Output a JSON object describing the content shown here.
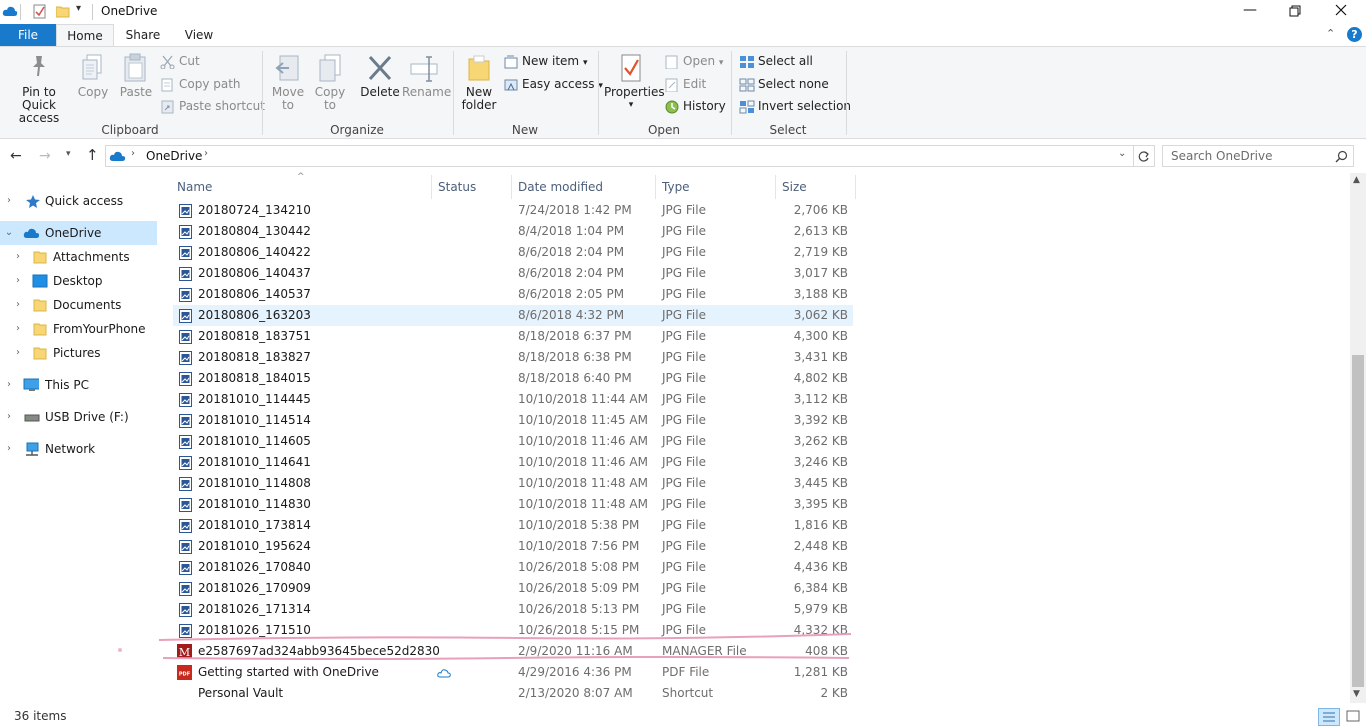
{
  "window": {
    "title": "OneDrive",
    "qat_dropdown_icon": "chevron-down-icon"
  },
  "ribbon_tabs": [
    {
      "label": "File"
    },
    {
      "label": "Home"
    },
    {
      "label": "Share"
    },
    {
      "label": "View"
    }
  ],
  "ribbon": {
    "clipboard": {
      "label": "Clipboard",
      "pin": "Pin to Quick",
      "pin2": "access",
      "copy": "Copy",
      "paste": "Paste",
      "cut": "Cut",
      "copy_path": "Copy path",
      "paste_shortcut": "Paste shortcut"
    },
    "organize": {
      "label": "Organize",
      "move": "Move",
      "move2": "to",
      "copy": "Copy",
      "copy2": "to",
      "delete": "Delete",
      "rename": "Rename"
    },
    "new": {
      "label": "New",
      "new_folder": "New",
      "new_folder2": "folder",
      "new_item": "New item",
      "easy_access": "Easy access"
    },
    "open": {
      "label": "Open",
      "properties": "Properties",
      "open": "Open",
      "edit": "Edit",
      "history": "History"
    },
    "select": {
      "label": "Select",
      "select_all": "Select all",
      "select_none": "Select none",
      "invert": "Invert selection"
    }
  },
  "address": {
    "path": "OneDrive",
    "search_placeholder": "Search OneDrive"
  },
  "nav": [
    {
      "label": "Quick access",
      "icon": "star-icon"
    },
    {
      "label": "OneDrive",
      "icon": "cloud-icon"
    },
    {
      "label": "Attachments",
      "icon": "folder-icon"
    },
    {
      "label": "Desktop",
      "icon": "desktop-icon"
    },
    {
      "label": "Documents",
      "icon": "folder-icon"
    },
    {
      "label": "FromYourPhone",
      "icon": "folder-icon"
    },
    {
      "label": "Pictures",
      "icon": "folder-icon"
    },
    {
      "label": "This PC",
      "icon": "computer-icon"
    },
    {
      "label": "USB Drive (F:)",
      "icon": "usb-drive-icon"
    },
    {
      "label": "Network",
      "icon": "network-icon"
    }
  ],
  "columns": {
    "name": "Name",
    "status": "Status",
    "date": "Date modified",
    "type": "Type",
    "size": "Size"
  },
  "files": [
    {
      "name": "20180724_134210",
      "date": "7/24/2018 1:42 PM",
      "type": "JPG File",
      "size": "2,706 KB",
      "icon": "image-file-icon"
    },
    {
      "name": "20180804_130442",
      "date": "8/4/2018 1:04 PM",
      "type": "JPG File",
      "size": "2,613 KB",
      "icon": "image-file-icon"
    },
    {
      "name": "20180806_140422",
      "date": "8/6/2018 2:04 PM",
      "type": "JPG File",
      "size": "2,719 KB",
      "icon": "image-file-icon"
    },
    {
      "name": "20180806_140437",
      "date": "8/6/2018 2:04 PM",
      "type": "JPG File",
      "size": "3,017 KB",
      "icon": "image-file-icon"
    },
    {
      "name": "20180806_140537",
      "date": "8/6/2018 2:05 PM",
      "type": "JPG File",
      "size": "3,188 KB",
      "icon": "image-file-icon"
    },
    {
      "name": "20180806_163203",
      "date": "8/6/2018 4:32 PM",
      "type": "JPG File",
      "size": "3,062 KB",
      "icon": "image-file-icon"
    },
    {
      "name": "20180818_183751",
      "date": "8/18/2018 6:37 PM",
      "type": "JPG File",
      "size": "4,300 KB",
      "icon": "image-file-icon"
    },
    {
      "name": "20180818_183827",
      "date": "8/18/2018 6:38 PM",
      "type": "JPG File",
      "size": "3,431 KB",
      "icon": "image-file-icon"
    },
    {
      "name": "20180818_184015",
      "date": "8/18/2018 6:40 PM",
      "type": "JPG File",
      "size": "4,802 KB",
      "icon": "image-file-icon"
    },
    {
      "name": "20181010_114445",
      "date": "10/10/2018 11:44 AM",
      "type": "JPG File",
      "size": "3,112 KB",
      "icon": "image-file-icon"
    },
    {
      "name": "20181010_114514",
      "date": "10/10/2018 11:45 AM",
      "type": "JPG File",
      "size": "3,392 KB",
      "icon": "image-file-icon"
    },
    {
      "name": "20181010_114605",
      "date": "10/10/2018 11:46 AM",
      "type": "JPG File",
      "size": "3,262 KB",
      "icon": "image-file-icon"
    },
    {
      "name": "20181010_114641",
      "date": "10/10/2018 11:46 AM",
      "type": "JPG File",
      "size": "3,246 KB",
      "icon": "image-file-icon"
    },
    {
      "name": "20181010_114808",
      "date": "10/10/2018 11:48 AM",
      "type": "JPG File",
      "size": "3,445 KB",
      "icon": "image-file-icon"
    },
    {
      "name": "20181010_114830",
      "date": "10/10/2018 11:48 AM",
      "type": "JPG File",
      "size": "3,395 KB",
      "icon": "image-file-icon"
    },
    {
      "name": "20181010_173814",
      "date": "10/10/2018 5:38 PM",
      "type": "JPG File",
      "size": "1,816 KB",
      "icon": "image-file-icon"
    },
    {
      "name": "20181010_195624",
      "date": "10/10/2018 7:56 PM",
      "type": "JPG File",
      "size": "2,448 KB",
      "icon": "image-file-icon"
    },
    {
      "name": "20181026_170840",
      "date": "10/26/2018 5:08 PM",
      "type": "JPG File",
      "size": "4,436 KB",
      "icon": "image-file-icon"
    },
    {
      "name": "20181026_170909",
      "date": "10/26/2018 5:09 PM",
      "type": "JPG File",
      "size": "6,384 KB",
      "icon": "image-file-icon"
    },
    {
      "name": "20181026_171314",
      "date": "10/26/2018 5:13 PM",
      "type": "JPG File",
      "size": "5,979 KB",
      "icon": "image-file-icon"
    },
    {
      "name": "20181026_171510",
      "date": "10/26/2018 5:15 PM",
      "type": "JPG File",
      "size": "4,332 KB",
      "icon": "image-file-icon"
    },
    {
      "name": "e2587697ad324abb93645bece52d2830",
      "date": "2/9/2020 11:16 AM",
      "type": "MANAGER File",
      "size": "408 KB",
      "icon": "manager-file-icon"
    },
    {
      "name": "Getting started with OneDrive",
      "date": "4/29/2016 4:36 PM",
      "type": "PDF File",
      "size": "1,281 KB",
      "icon": "pdf-file-icon"
    },
    {
      "name": "Personal Vault",
      "date": "2/13/2020 8:07 AM",
      "type": "Shortcut",
      "size": "2 KB",
      "icon": "vault-icon"
    }
  ],
  "status": {
    "count": "36 items"
  },
  "colors": {
    "accent": "#1979ca",
    "selection": "#e5f3ff",
    "highlight_marks": "#e8a0bc"
  }
}
